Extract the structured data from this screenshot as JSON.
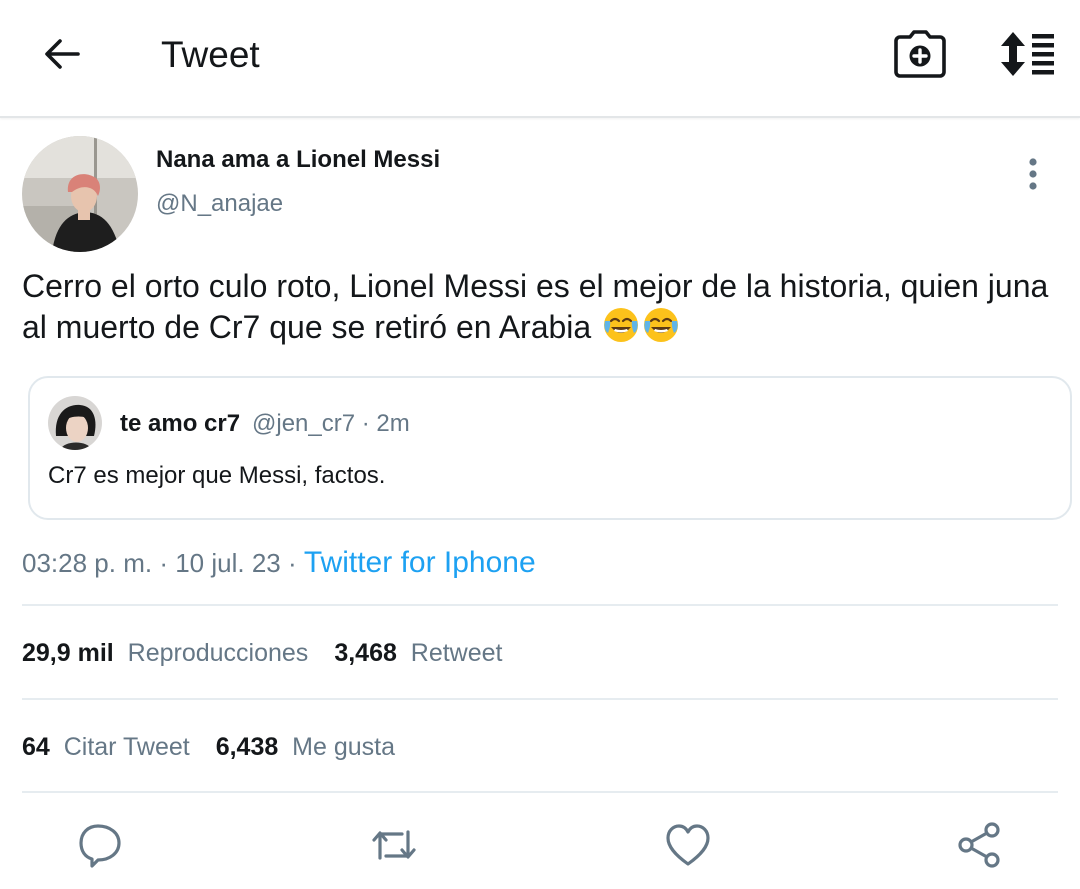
{
  "header": {
    "title": "Tweet"
  },
  "tweet": {
    "author_name": "Nana ama a Lionel Messi",
    "author_handle": "@N_anajae",
    "text": "Cerro el orto culo roto, Lionel Messi es el mejor de la historia, quien juna al muerto de Cr7 que se retiró en Arabia",
    "emojis": [
      "face-with-tears-of-joy",
      "face-with-tears-of-joy"
    ],
    "time": "03:28 p. m.",
    "date": "10 jul. 23",
    "separator": "·",
    "source": "Twitter for Iphone"
  },
  "quoted": {
    "name": "te amo cr7",
    "handle": "@jen_cr7",
    "age": "· 2m",
    "text": "Cr7 es mejor que Messi, factos."
  },
  "stats": {
    "views_count": "29,9 mil",
    "views_label": "Reproducciones",
    "retweets_count": "3,468",
    "retweets_label": "Retweet",
    "quotes_count": "64",
    "quotes_label": "Citar Tweet",
    "likes_count": "6,438",
    "likes_label": "Me gusta"
  },
  "actions": [
    "reply-icon",
    "retweet-icon",
    "like-icon",
    "share-icon"
  ],
  "colors": {
    "link": "#1da1f2",
    "secondary_text": "#657786",
    "primary_text": "#14171a",
    "divider": "#e6ecf0"
  }
}
